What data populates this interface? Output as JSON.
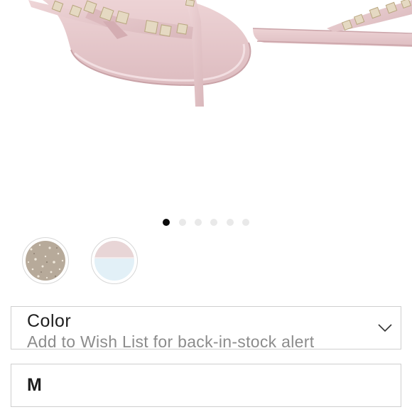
{
  "gallery": {
    "image_alt": "pink studded jelly thong sandals",
    "slide_count": 6,
    "active_slide": 1
  },
  "swatches": [
    {
      "name": "glitter",
      "colors": [
        "#b3a697",
        "#ddd3c6"
      ]
    },
    {
      "name": "pink-blue",
      "colors": [
        "#e6d3d3",
        "#e3f1f8"
      ]
    }
  ],
  "color_select": {
    "label": "Color",
    "hint": "Add to Wish List for back-in-stock alert",
    "icon": "chevron-down-icon"
  },
  "size_select": {
    "value": "M"
  },
  "colors": {
    "sandal_pink": "#e9ccd0",
    "stud_gold": "#e3d7bf",
    "border": "#cfcfcf",
    "dot_active": "#0b0b0b",
    "dot_inactive": "#e9e9e9"
  }
}
